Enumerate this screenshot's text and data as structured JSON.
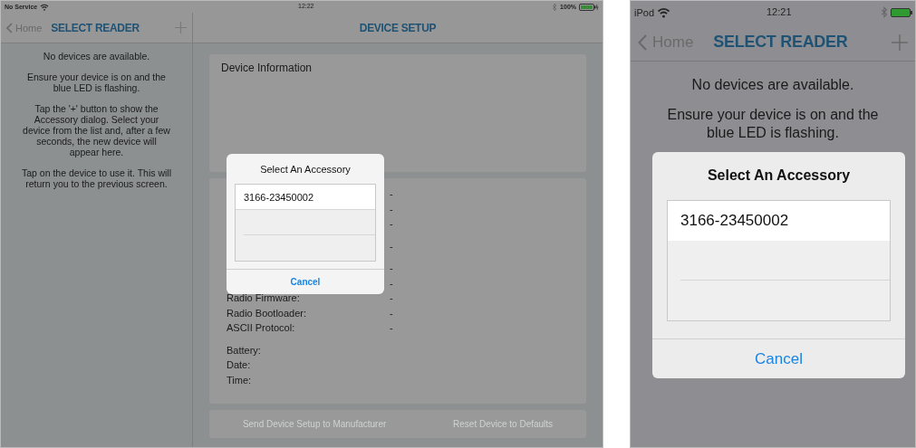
{
  "tablet": {
    "status_bar": {
      "carrier": "No Service",
      "time": "12:22",
      "battery": "100%"
    },
    "master": {
      "back": "Home",
      "title": "SELECT READER",
      "messages": [
        "No devices are available.",
        "Ensure your device is on and the blue LED is flashing.",
        "Tap the '+' button to show the Accessory dialog. Select your device from the list and, after a few seconds, the new device will appear here.",
        "Tap on the device to use it. This will return you to the previous screen."
      ]
    },
    "detail": {
      "title": "DEVICE SETUP",
      "info_title": "Device Information",
      "groups": [
        [
          {
            "value": "-"
          },
          {
            "value": "-"
          },
          {
            "value": "-"
          }
        ],
        [
          {
            "value": "-"
          }
        ],
        [
          {
            "value": "-"
          },
          {
            "value": "-"
          },
          {
            "label": "Radio Firmware:",
            "value": "-"
          },
          {
            "label": "Radio Bootloader:",
            "value": "-"
          },
          {
            "label": "ASCII Protocol:",
            "value": "-"
          }
        ],
        [
          {
            "label": "Battery:"
          },
          {
            "label": "Date:"
          },
          {
            "label": "Time:"
          }
        ]
      ],
      "buttons": [
        {
          "label": "Send Device Setup to Manufacturer",
          "disabled": true
        },
        {
          "label": "Reset Device to Defaults",
          "disabled": true
        }
      ]
    },
    "dialog": {
      "title": "Select An Accessory",
      "items": [
        "3166-23450002"
      ],
      "cancel": "Cancel"
    }
  },
  "phone": {
    "status_bar": {
      "carrier": "iPod",
      "time": "12:21"
    },
    "back": "Home",
    "title": "SELECT READER",
    "messages": [
      "No devices are available.",
      "Ensure your device is on and the blue LED is flashing."
    ],
    "dialog": {
      "title": "Select An Accessory",
      "items": [
        "3166-23450002"
      ],
      "cancel": "Cancel"
    }
  }
}
